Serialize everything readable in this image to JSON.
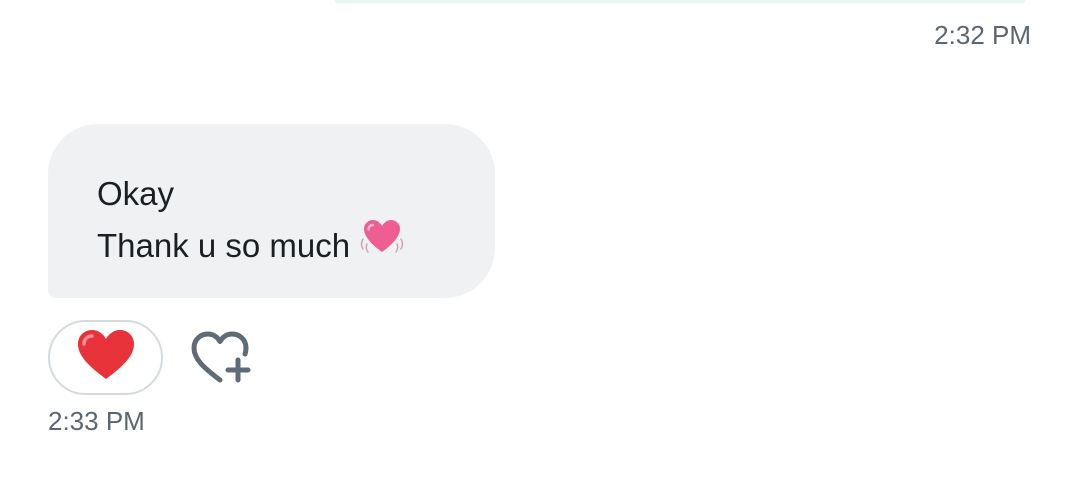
{
  "thread": {
    "previous_message": {
      "timestamp": "2:32 PM"
    },
    "message": {
      "lines": [
        "Okay",
        "Thank u so much"
      ],
      "emoji": "beating-heart-emoji",
      "timestamp": "2:33 PM",
      "reactions": [
        {
          "emoji": "red-heart-emoji"
        }
      ],
      "add_reaction_icon": "heart-plus-icon"
    }
  },
  "colors": {
    "bubble_background": "#eff1f3",
    "message_text": "#1b1f23",
    "timestamp_text": "#5b6670",
    "reaction_border": "#d4dadf",
    "heart_red": "#e8323a",
    "heart_pink": "#ef5d93",
    "icon_gray": "#5f6b76"
  }
}
